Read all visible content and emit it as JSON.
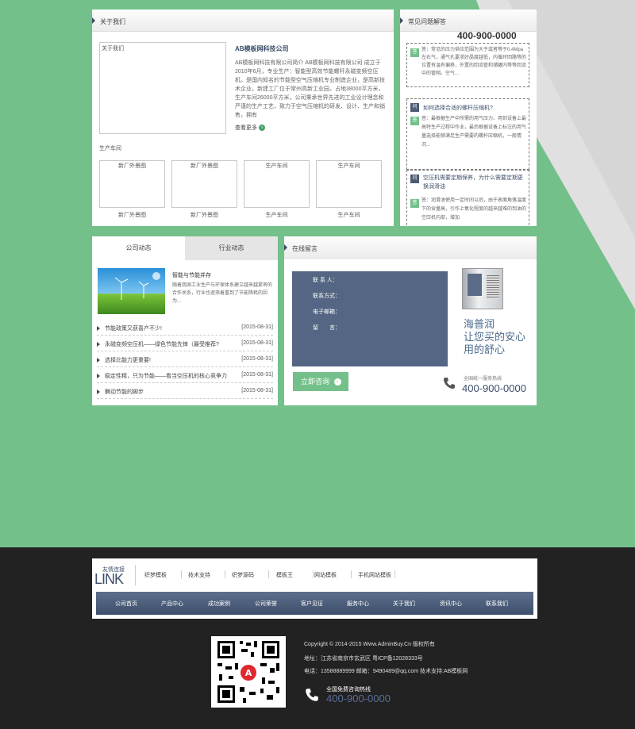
{
  "colors": {
    "accent_green": "#74c08a",
    "navy": "#3d4f6b",
    "footer_bg": "#222222"
  },
  "about": {
    "header": "关于我们",
    "img_alt": "关于我们",
    "company": "AB模板网科技公司",
    "desc": "AB模板网科技有限公司简介 AB模板网科技有限公司 成立于2010年6月，专业生产：智能型高效节能螺杆永磁变频空压机。是国内知名的节能型空气压缩机专业制造企业，是高新技术企业，新建工厂位于常州高新工业园，占地38000平方米，生产车间26000平方米，公司秉承世界先进的工业设计理念和严谨的生产工艺，致力于空气压缩机的研发、设计、生产和销售，拥有",
    "more": "查看更多",
    "workshop_label": "生产车间",
    "gallery": [
      {
        "img": "新厂外景图",
        "caption": "新厂外景图"
      },
      {
        "img": "新厂外景图",
        "caption": "新厂外景图"
      },
      {
        "img": "生产车间",
        "caption": "生产车间"
      },
      {
        "img": "生产车间",
        "caption": "生产车间"
      }
    ]
  },
  "faq": {
    "header": "常见问题解答",
    "phone": "400-900-0000",
    "items": [
      {
        "q": "",
        "a": "答：常见的压力供应范围为大于或者等于0.4Mpa左右气，通气孔要求好晶度越低，内循环回路等的位置有温有偏移，外置的回流管和储罐内等等回流中的管网。空气..."
      },
      {
        "q": "如何选择合适的螺杆压缩机?",
        "a": "答：最根据生产中所需的用气压力、用到设备上最高特生产过程中作业，最后根据设备上标注的用气量选择能够满足生产需要的螺杆压缩机，一般情况..."
      },
      {
        "q": "空压机需要定期保养，为什么需要定期更换润滑油",
        "a": "答：润滑油使用一定时间以后，由于表面角落温度下的含量高，引作上氧化程度的越来越难的到油的空压机内部，增加"
      }
    ]
  },
  "news": {
    "tabs": [
      "公司动态",
      "行业动态"
    ],
    "feature": {
      "title": "智能与节能并存",
      "desc": "随着我国工业生产与环保体系建立越来越紧密的合作关系，行业也逐渐着重到了节能降耗的因为..."
    },
    "items": [
      {
        "title": "节能政策又获喜产不少!",
        "date": "[2015-08-31]"
      },
      {
        "title": "永磁变频空压机——绿色节能先锋（最受推荐?",
        "date": "[2015-08-31]"
      },
      {
        "title": "选择比能力更重要!",
        "date": "[2015-08-31]"
      },
      {
        "title": "稳定性精，只为节能——看当空压机的核心竞争力",
        "date": "[2015-08-31]"
      },
      {
        "title": "舞动节能的脚步",
        "date": "[2015-08-31]"
      }
    ]
  },
  "message": {
    "header": "在线留言",
    "fields": [
      "联 系 人：",
      "联系方式：",
      "电子邮箱：",
      "留　　言："
    ],
    "button": "立即咨询",
    "slogan1": "海普润",
    "slogan2": "让您买的安心",
    "slogan3": "用的舒心",
    "hotline_label": "全国统一服务热线",
    "phone": "400-900-0000"
  },
  "links": {
    "title_top": "友情连接",
    "title_big": "LINK",
    "items": [
      "织梦模板",
      "技术支持",
      "织梦源码",
      "模板王",
      "网站模板",
      "手机网站模板"
    ]
  },
  "nav": [
    "公司首页",
    "产品中心",
    "成功案例",
    "公司荣誉",
    "客户见证",
    "服务中心",
    "关于我们",
    "资讯中心",
    "联系我们"
  ],
  "footer": {
    "copyright": "Copyright © 2014-2015 Www.AdminBuy.Cn 版权所有",
    "address": "地址：江苏省南京市玄武区  粤ICP备12028333号",
    "contact": "电话：13588889999 邮箱：9490489@qq.com 技术支持:AB模板网",
    "hotline_label": "全国免费咨询热线",
    "phone": "400-900-0000"
  }
}
